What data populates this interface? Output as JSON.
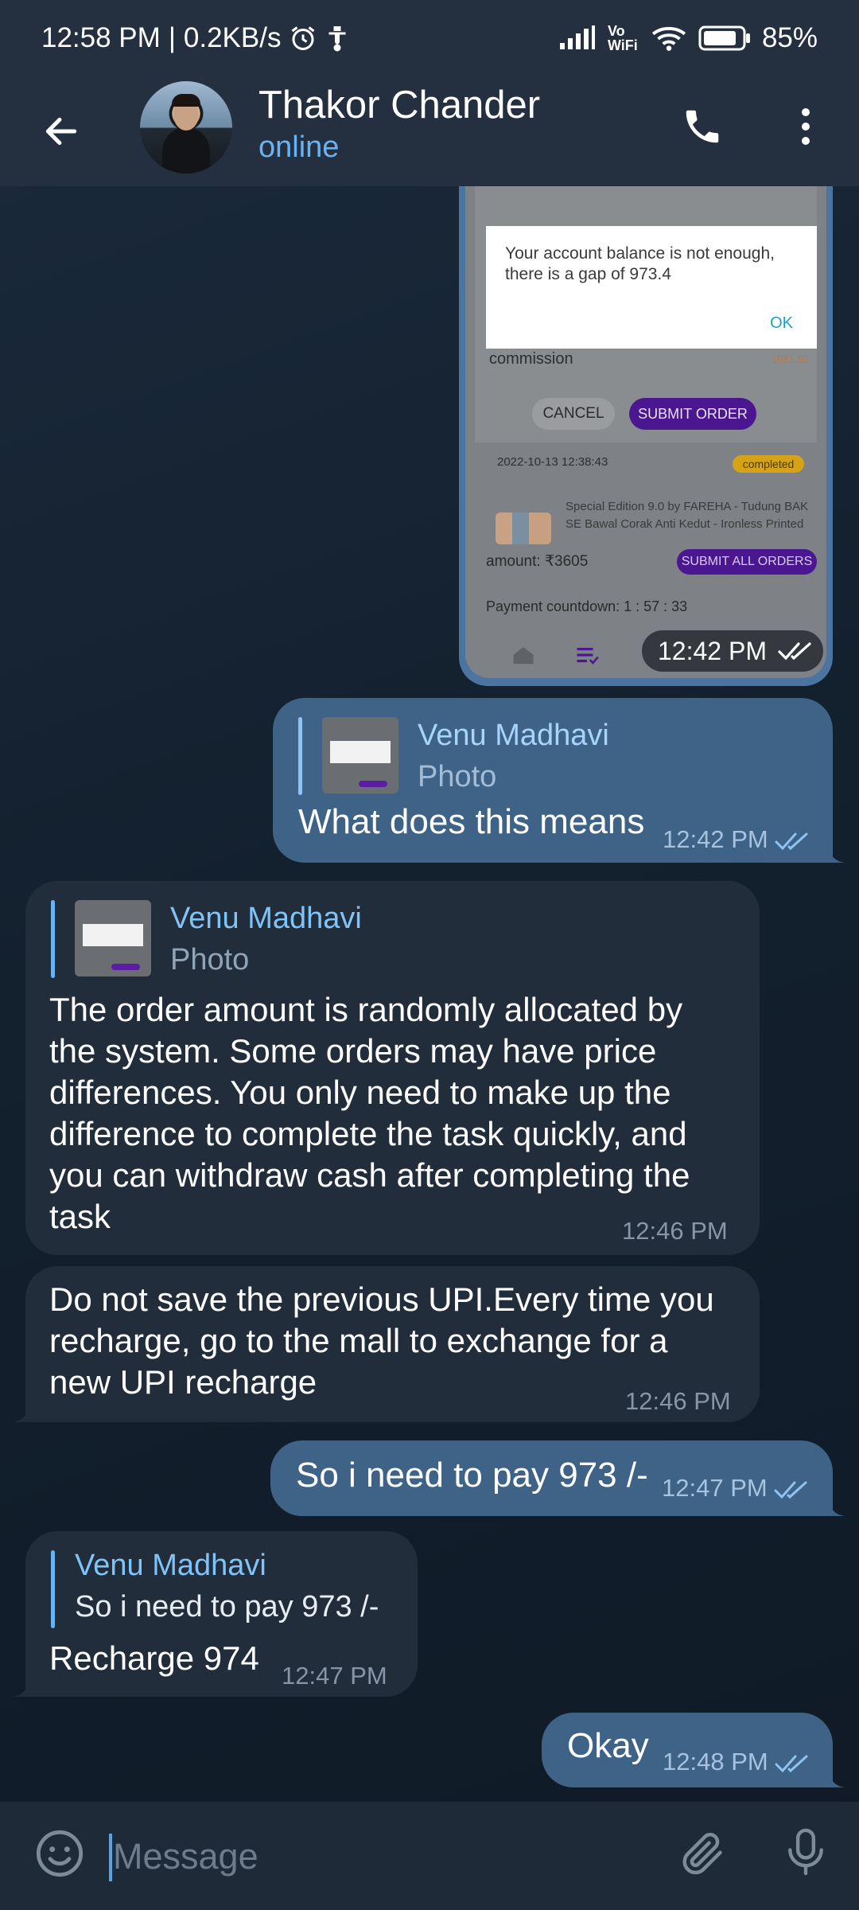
{
  "status_bar": {
    "time": "12:58 PM",
    "separator": "|",
    "network_speed": "0.2KB/s",
    "vowifi_label": "Vo WiFi",
    "battery_percent": "85%"
  },
  "header": {
    "contact_name": "Thakor Chander",
    "contact_status": "online"
  },
  "photo_message": {
    "dialog_text": "Your account balance is not enough, there is a gap of 973.4",
    "dialog_ok": "OK",
    "commission_label": "commission",
    "commission_value": "1081.50",
    "cancel_label": "CANCEL",
    "submit_label": "SUBMIT ORDER",
    "order_date": "2022-10-13 12:38:43",
    "order_status": "completed",
    "product_name": "Special Edition 9.0 by FAREHA - Tudung BAK SE Bawal Corak Anti Kedut - Ironless Printed",
    "amount_label": "amount:",
    "amount_value": "₹3605",
    "submit_all_label": "SUBMIT ALL ORDERS",
    "countdown_text": "Payment countdown: 1 : 57 : 33",
    "time": "12:42 PM"
  },
  "messages": [
    {
      "direction": "outgoing",
      "reply_to_name": "Venu Madhavi",
      "reply_to_preview": "Photo",
      "text": "What does this means",
      "time": "12:42 PM"
    },
    {
      "direction": "incoming",
      "reply_to_name": "Venu Madhavi",
      "reply_to_preview": "Photo",
      "text_lines": [
        "The order amount is randomly allocated by",
        "the system. Some orders may have price",
        "differences. You only need to make up the",
        "difference to complete the task quickly, and",
        "you can withdraw cash after completing the",
        "task"
      ],
      "time": "12:46 PM"
    },
    {
      "direction": "incoming",
      "text_lines": [
        "Do not save the previous UPI.Every time you",
        "recharge, go to the mall to exchange for a",
        "new UPI recharge"
      ],
      "time": "12:46 PM"
    },
    {
      "direction": "outgoing",
      "text": "So i need to pay 973 /-",
      "time": "12:47 PM"
    },
    {
      "direction": "incoming",
      "reply_to_name": "Venu Madhavi",
      "reply_to_preview": "So i need to pay 973 /-",
      "text": "Recharge 974",
      "time": "12:47 PM"
    },
    {
      "direction": "outgoing",
      "text": "Okay",
      "time": "12:48 PM"
    }
  ],
  "input": {
    "placeholder": "Message"
  },
  "colors": {
    "outgoing_bubble": "#3e6387",
    "incoming_bubble": "#222d3b",
    "accent": "#6ab3f3",
    "header_bg": "#243040"
  }
}
